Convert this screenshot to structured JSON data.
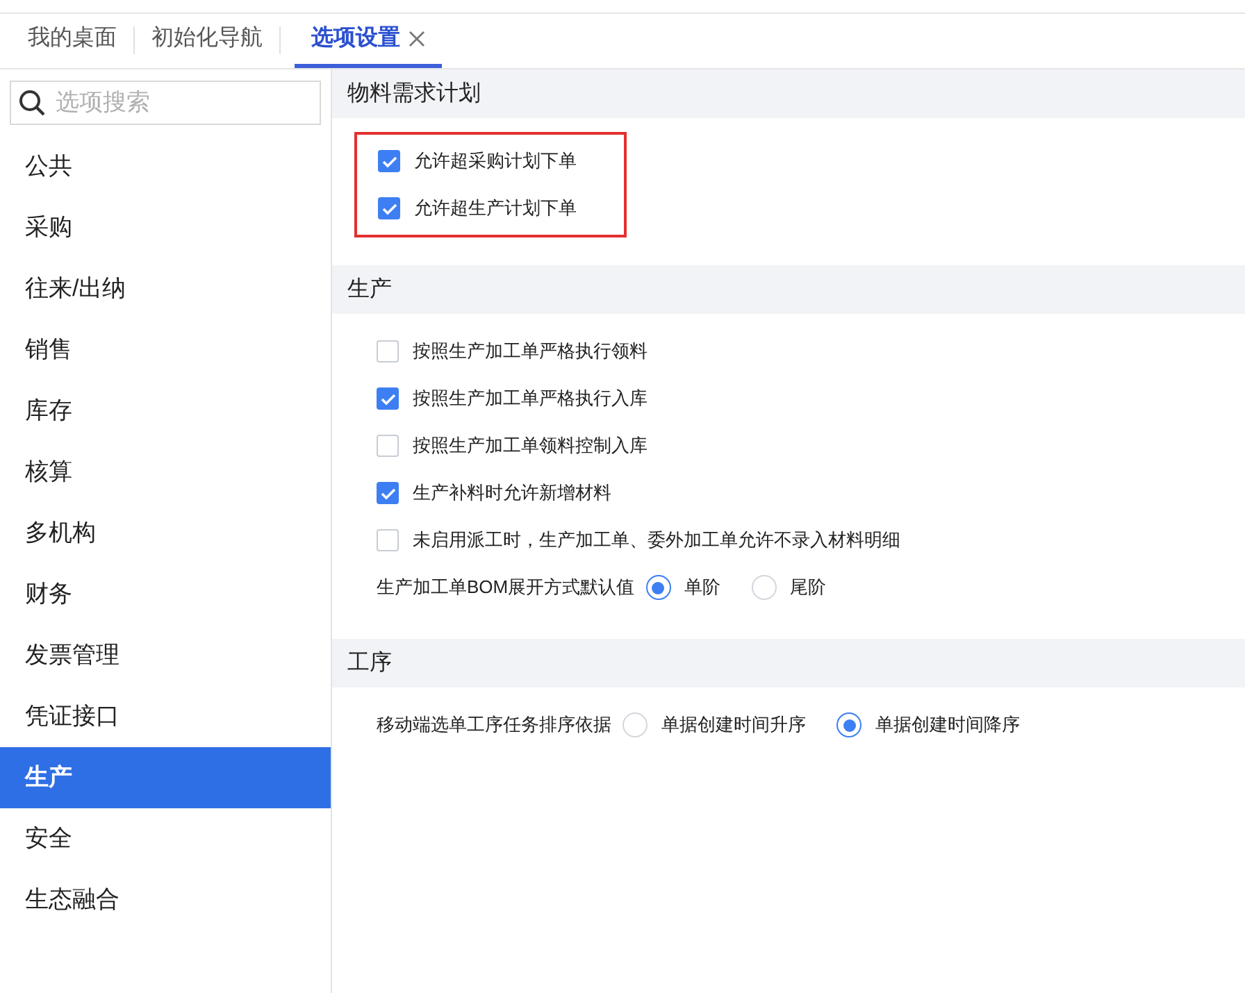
{
  "tabs": [
    {
      "label": "我的桌面",
      "selected": false,
      "closable": false
    },
    {
      "label": "初始化导航",
      "selected": false,
      "closable": false
    },
    {
      "label": "选项设置",
      "selected": true,
      "closable": true
    }
  ],
  "search": {
    "placeholder": "选项搜索"
  },
  "sidebar": {
    "items": [
      {
        "label": "公共",
        "selected": false
      },
      {
        "label": "采购",
        "selected": false
      },
      {
        "label": "往来/出纳",
        "selected": false
      },
      {
        "label": "销售",
        "selected": false
      },
      {
        "label": "库存",
        "selected": false
      },
      {
        "label": "核算",
        "selected": false
      },
      {
        "label": "多机构",
        "selected": false
      },
      {
        "label": "财务",
        "selected": false
      },
      {
        "label": "发票管理",
        "selected": false
      },
      {
        "label": "凭证接口",
        "selected": false
      },
      {
        "label": "生产",
        "selected": true
      },
      {
        "label": "安全",
        "selected": false
      },
      {
        "label": "生态融合",
        "selected": false
      }
    ]
  },
  "sections": [
    {
      "title": "物料需求计划",
      "highlighted": true,
      "rows": [
        {
          "kind": "checkbox",
          "label": "允许超采购计划下单",
          "checked": true
        },
        {
          "kind": "checkbox",
          "label": "允许超生产计划下单",
          "checked": true
        }
      ]
    },
    {
      "title": "生产",
      "highlighted": false,
      "rows": [
        {
          "kind": "checkbox",
          "label": "按照生产加工单严格执行领料",
          "checked": false
        },
        {
          "kind": "checkbox",
          "label": "按照生产加工单严格执行入库",
          "checked": true
        },
        {
          "kind": "checkbox",
          "label": "按照生产加工单领料控制入库",
          "checked": false
        },
        {
          "kind": "checkbox",
          "label": "生产补料时允许新增材料",
          "checked": true
        },
        {
          "kind": "checkbox",
          "label": "未启用派工时，生产加工单、委外加工单允许不录入材料明细",
          "checked": false
        },
        {
          "kind": "radio",
          "label": "生产加工单BOM展开方式默认值",
          "options": [
            {
              "label": "单阶",
              "selected": true
            },
            {
              "label": "尾阶",
              "selected": false
            }
          ]
        }
      ]
    },
    {
      "title": "工序",
      "highlighted": false,
      "rows": [
        {
          "kind": "radio",
          "label": "移动端选单工序任务排序依据",
          "options": [
            {
              "label": "单据创建时间升序",
              "selected": false
            },
            {
              "label": "单据创建时间降序",
              "selected": true
            }
          ]
        }
      ]
    }
  ]
}
